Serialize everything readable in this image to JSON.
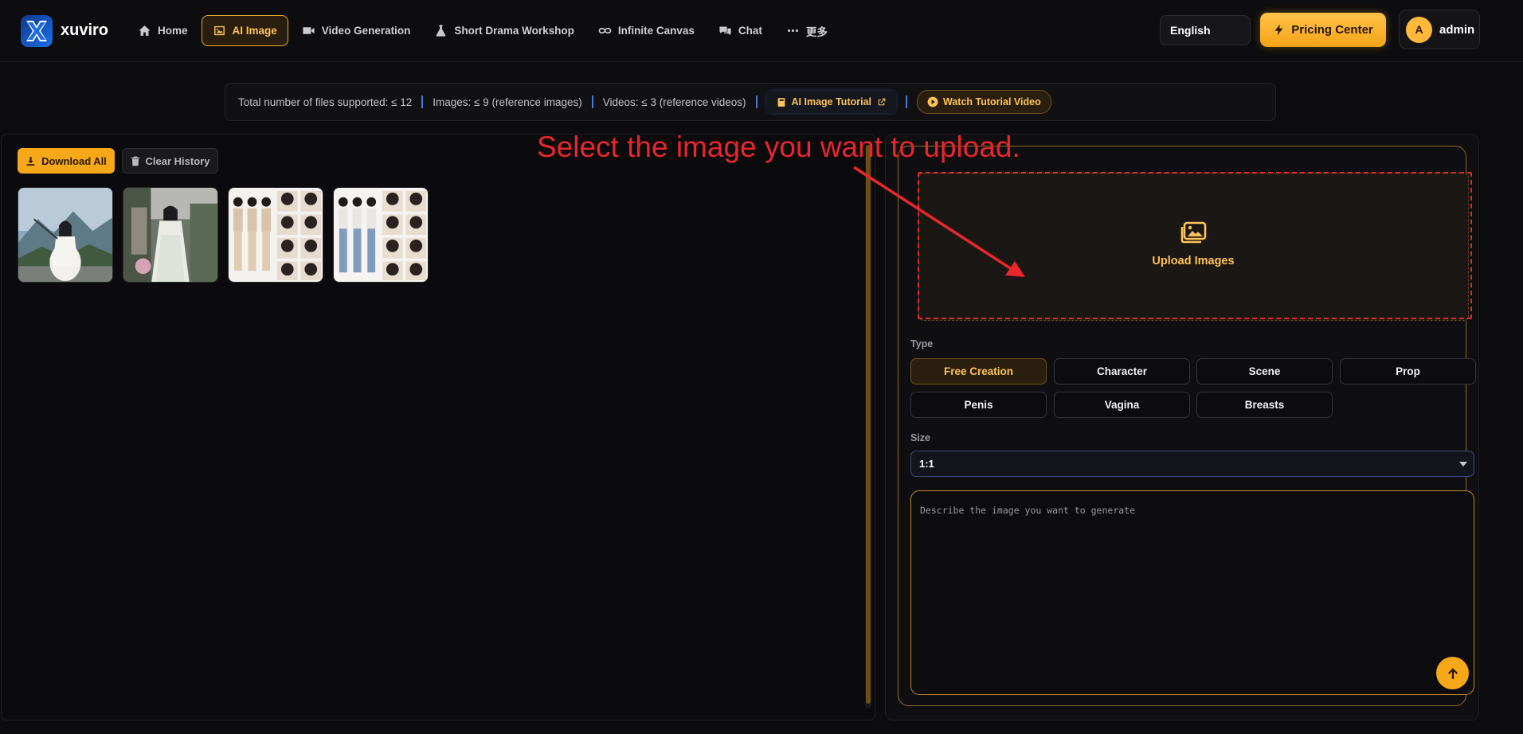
{
  "header": {
    "brand": "xuviro",
    "nav": [
      {
        "label": "Home",
        "icon": "home-icon"
      },
      {
        "label": "AI Image",
        "icon": "image-icon",
        "active": true
      },
      {
        "label": "Video Generation",
        "icon": "video-icon"
      },
      {
        "label": "Short Drama Workshop",
        "icon": "flask-icon"
      },
      {
        "label": "Infinite Canvas",
        "icon": "infinity-icon"
      },
      {
        "label": "Chat",
        "icon": "chat-icon"
      },
      {
        "label": "更多",
        "icon": "more-icon"
      }
    ],
    "language": "English",
    "pricing_label": "Pricing Center",
    "user": {
      "avatar_letter": "A",
      "name": "admin"
    }
  },
  "info_bar": {
    "total_files": "Total number of files supported: ≤ 12",
    "images": "Images: ≤ 9 (reference images)",
    "videos": "Videos: ≤ 3 (reference videos)",
    "tutorial_label": "AI Image Tutorial",
    "watch_label": "Watch Tutorial Video"
  },
  "history": {
    "download_all": "Download All",
    "clear_history": "Clear History",
    "thumbnails": [
      "thumbnail-1",
      "thumbnail-2",
      "thumbnail-3",
      "thumbnail-4"
    ]
  },
  "generator": {
    "upload_label": "Upload Images",
    "type_label": "Type",
    "types": [
      "Free Creation",
      "Character",
      "Scene",
      "Prop",
      "Penis",
      "Vagina",
      "Breasts"
    ],
    "selected_type": "Free Creation",
    "size_label": "Size",
    "size_value": "1:1",
    "prompt_placeholder": "Describe the image you want to generate"
  },
  "annotation": {
    "text": "Select the image you want to upload."
  },
  "colors": {
    "accent": "#f6a818",
    "accent_text": "#ffc35a",
    "annotation": "#e8262b",
    "background": "#0c0c0e"
  }
}
